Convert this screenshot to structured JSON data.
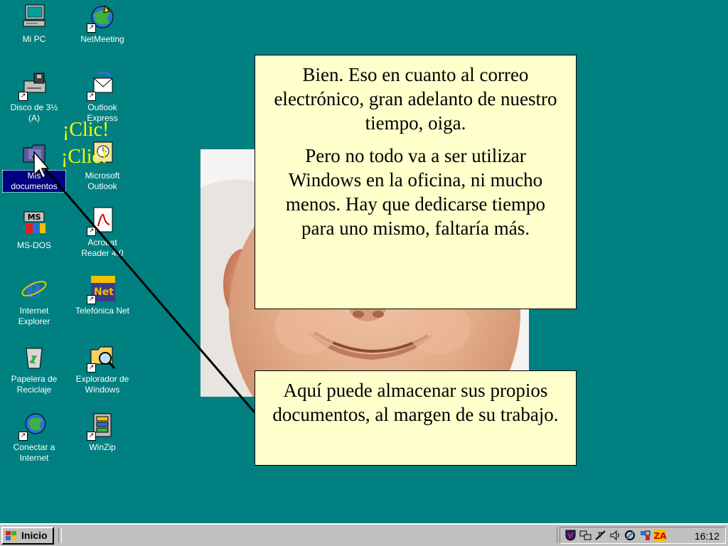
{
  "desktop": {
    "icons": [
      {
        "label": "Mi PC",
        "icon": "my-computer-icon"
      },
      {
        "label": "NetMeeting",
        "icon": "netmeeting-icon"
      },
      {
        "label": "Disco de 3½ (A)",
        "icon": "floppy-drive-icon"
      },
      {
        "label": "Outlook Express",
        "icon": "outlook-express-icon"
      },
      {
        "label": "Mis documentos",
        "icon": "my-documents-icon"
      },
      {
        "label": "Microsoft Outlook",
        "icon": "microsoft-outlook-icon"
      },
      {
        "label": "MS-DOS",
        "icon": "ms-dos-icon"
      },
      {
        "label": "Acrobat Reader 4.0",
        "icon": "acrobat-reader-icon"
      },
      {
        "label": "Internet Explorer",
        "icon": "internet-explorer-icon"
      },
      {
        "label": "Telefónica Net",
        "icon": "telefonica-net-icon"
      },
      {
        "label": "Papelera de Reciclaje",
        "icon": "recycle-bin-icon"
      },
      {
        "label": "Explorador de Windows",
        "icon": "windows-explorer-icon"
      },
      {
        "label": "Conectar a Internet",
        "icon": "connect-internet-icon"
      },
      {
        "label": "WinZip",
        "icon": "winzip-icon"
      }
    ],
    "selected_icon": "Mis documentos"
  },
  "annotation": {
    "clic1": "¡Clic!",
    "clic2": "¡Clic!"
  },
  "callouts": {
    "top_p1": "Bien. Eso en cuanto al correo electrónico, gran adelanto de nuestro tiempo, oiga.",
    "top_p2": "Pero no todo va a ser utilizar Windows en la oficina, ni mucho menos. Hay que dedicarse tiempo para uno mismo, faltaría más.",
    "bottom": "Aquí puede almacenar sus propios documentos, al margen de su trabajo."
  },
  "taskbar": {
    "start_label": "Inicio",
    "clock": "16:12",
    "tray_icons": [
      "antivirus-shield-icon",
      "network-icon",
      "connection-icon",
      "volume-icon",
      "tray-app-icon",
      "tray-app2-icon",
      "zonealarm-icon"
    ]
  },
  "colors": {
    "desktop_bg": "#008080",
    "callout_bg": "#ffffcc",
    "clic_text": "#ffff00",
    "selection": "#000080"
  }
}
